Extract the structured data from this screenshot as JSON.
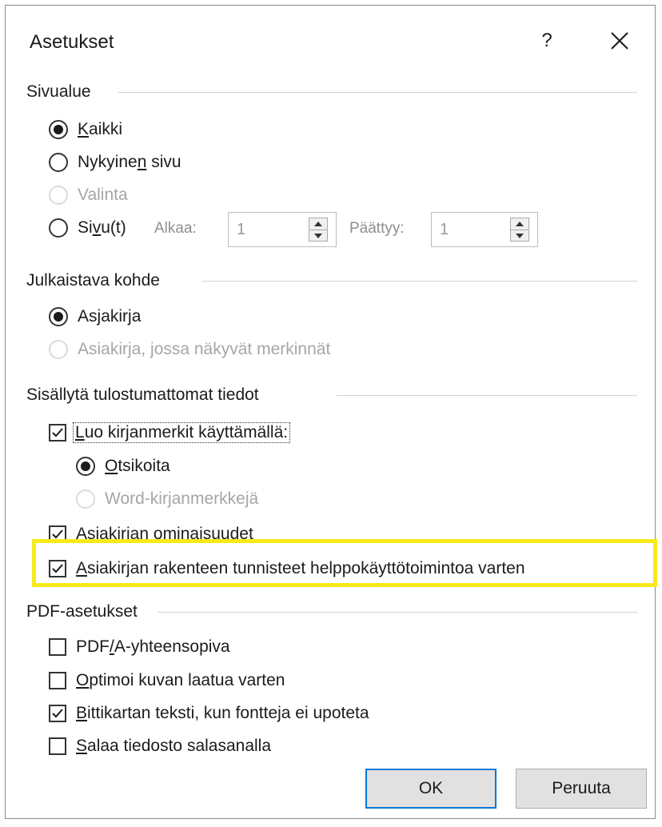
{
  "dialog": {
    "title": "Asetukset",
    "help_label": "?"
  },
  "page_range": {
    "heading": "Sivualue",
    "option_all": {
      "before": "",
      "accel": "K",
      "after": "aikki"
    },
    "option_current": {
      "before": "Nykyine",
      "accel": "n",
      "after": " sivu"
    },
    "option_selection": "Valinta",
    "option_pages": {
      "before": "Si",
      "accel": "v",
      "after": "u(t)"
    },
    "from_label": "Alkaa:",
    "from_value": "1",
    "to_label": "Päättyy:",
    "to_value": "1"
  },
  "publish_what": {
    "heading": "Julkaistava kohde",
    "option_document": {
      "before": "As",
      "accel": "j",
      "after": "akirja"
    },
    "option_markup": "Asiakirja, jossa näkyvät merkinnät"
  },
  "non_printing": {
    "heading": "Sisällytä tulostumattomat tiedot",
    "create_bookmarks": {
      "before": "",
      "accel": "L",
      "after": "uo kirjanmerkit käyttämällä:"
    },
    "headings_option": {
      "before": "",
      "accel": "O",
      "after": "tsikoita"
    },
    "word_bookmarks_option": "Word-kirjanmerkkejä",
    "doc_properties": {
      "before": "Asiakirjan ",
      "accel": "o",
      "after": "minaisuudet"
    },
    "structure_tags": {
      "before": "",
      "accel": "A",
      "after": "siakirjan rakenteen tunnisteet helppokäyttötoimintoa varten"
    }
  },
  "pdf_options": {
    "heading": "PDF-asetukset",
    "pdfa": {
      "before": "PDF",
      "accel": "/",
      "after": "A-yhteensopiva"
    },
    "optimize": {
      "before": "",
      "accel": "O",
      "after": "ptimoi kuvan laatua varten"
    },
    "bitmap_text": {
      "before": "",
      "accel": "B",
      "after": "ittikartan teksti, kun fontteja ei upoteta"
    },
    "encrypt": {
      "before": "",
      "accel": "S",
      "after": "alaa tiedosto salasanalla"
    }
  },
  "buttons": {
    "ok": "OK",
    "cancel": "Peruuta"
  },
  "colors": {
    "highlight": "#f7ea1a",
    "default_button_border": "#0078d7",
    "disabled_text": "#a6a6a6"
  },
  "icons": {
    "close": "close-icon",
    "spin_up": "chevron-up-icon",
    "spin_down": "chevron-down-icon",
    "check": "checkmark-icon"
  }
}
